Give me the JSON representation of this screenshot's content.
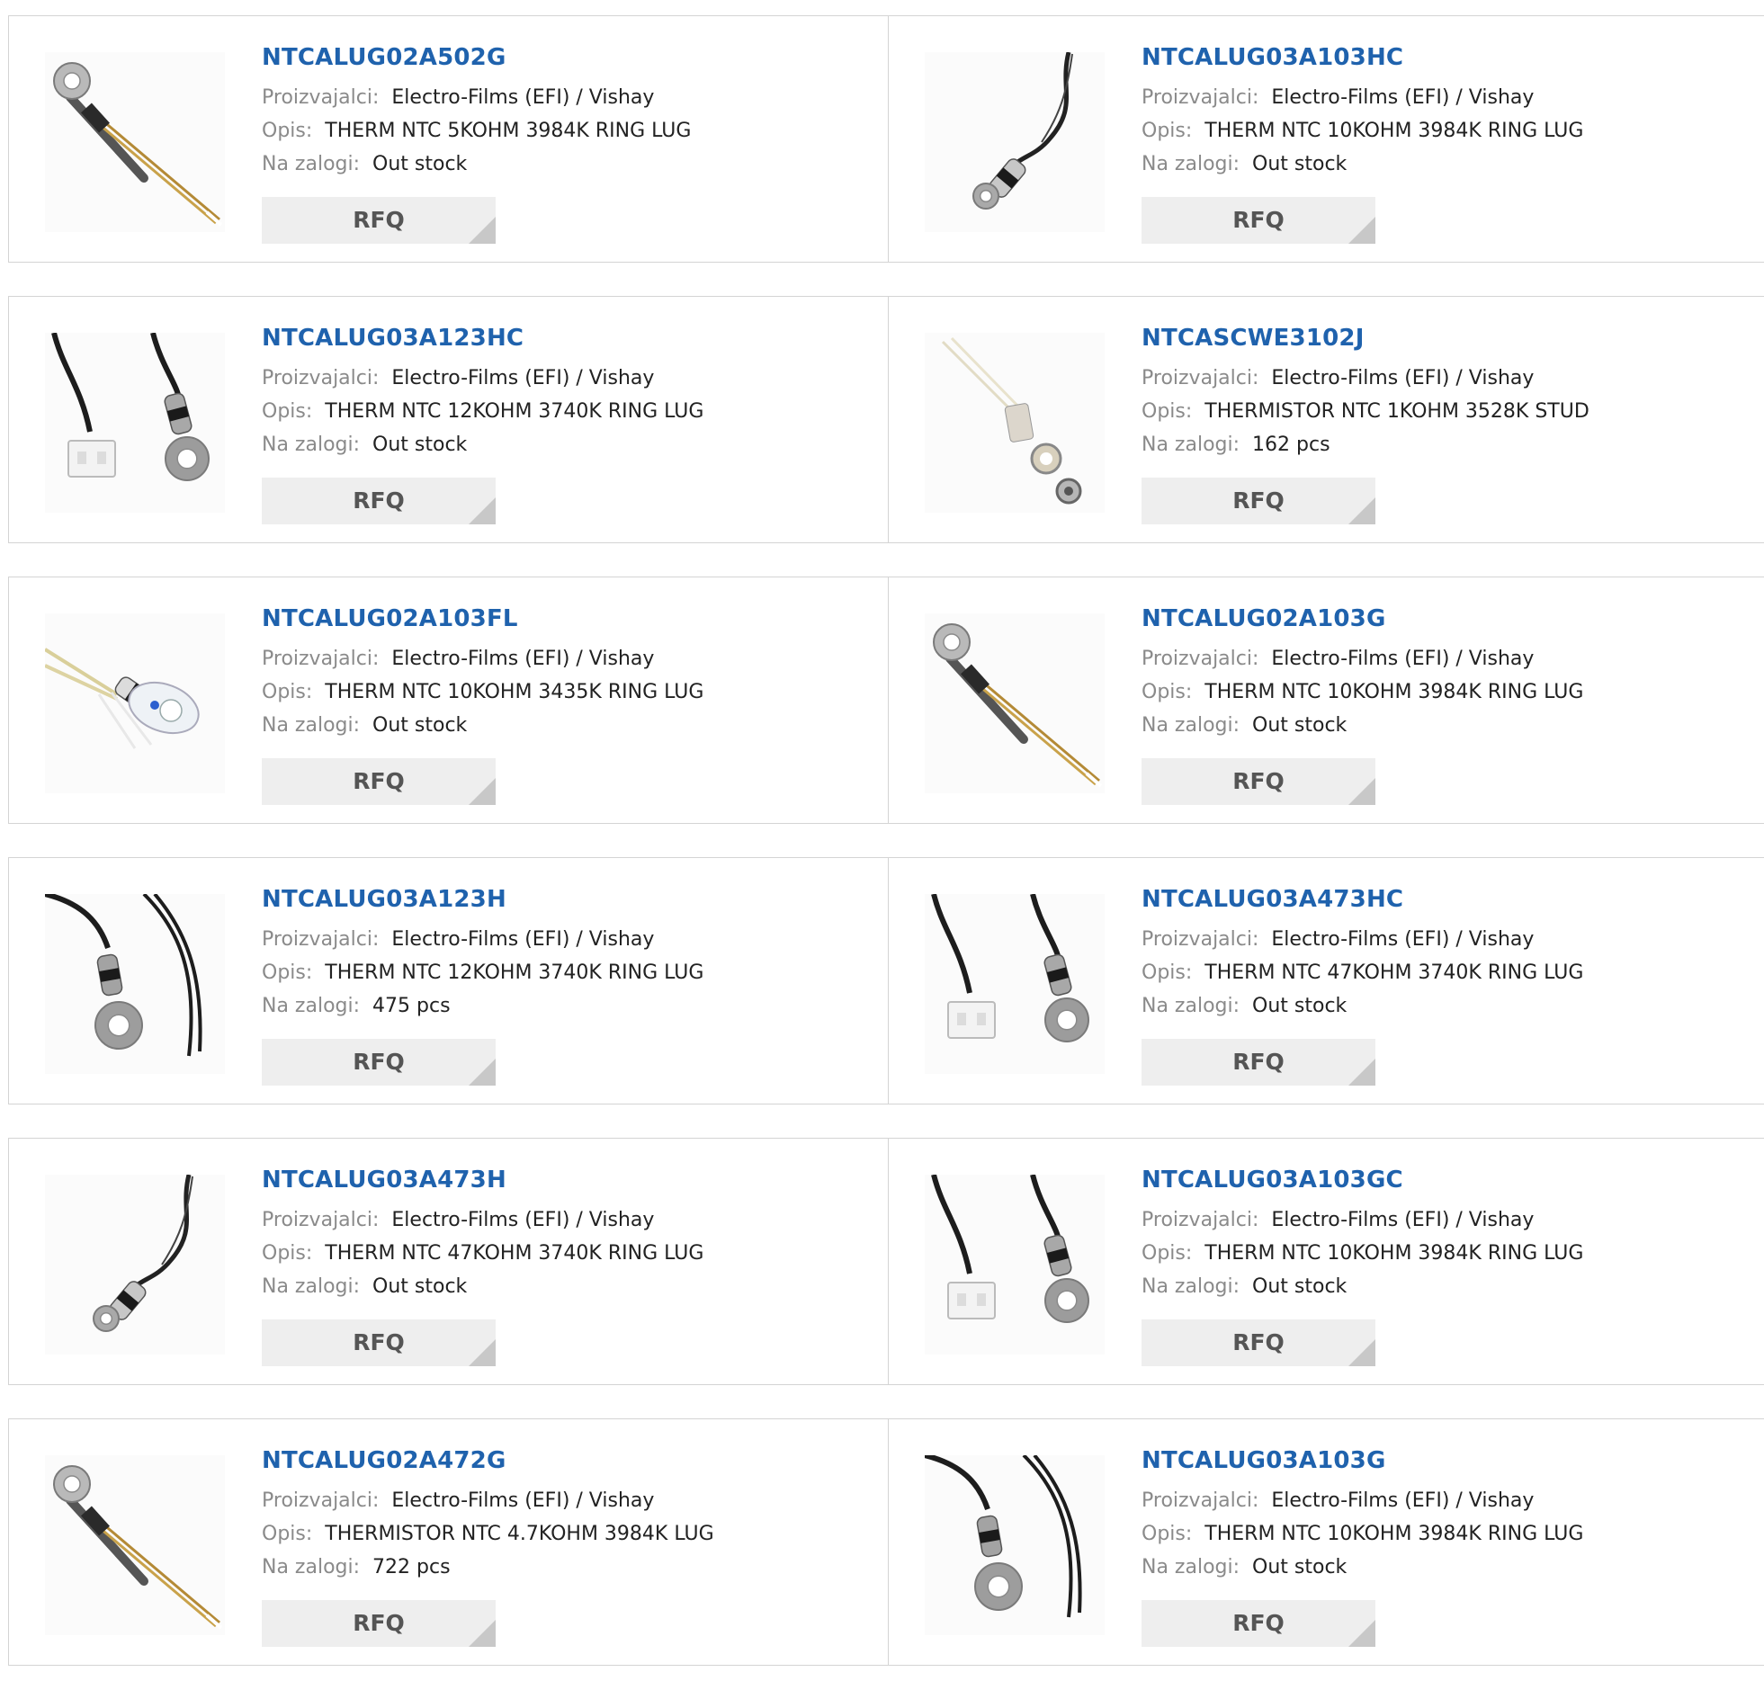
{
  "labels": {
    "manufacturer": "Proizvajalci:",
    "description": "Opis:",
    "stock": "Na zalogi:",
    "rfq": "RFQ"
  },
  "colors": {
    "title": "#1f62ad",
    "label": "#8a8a8a",
    "button_bg": "#eeeeee"
  },
  "products": [
    {
      "part": "NTCALUG02A502G",
      "manufacturer": "Electro-Films (EFI) / Vishay",
      "description": "THERM NTC 5KOHM 3984K RING LUG",
      "stock": "Out stock",
      "image": "ring-lug-gold-leads"
    },
    {
      "part": "NTCALUG03A103HC",
      "manufacturer": "Electro-Films (EFI) / Vishay",
      "description": "THERM NTC 10KOHM 3984K RING LUG",
      "stock": "Out stock",
      "image": "ring-lug-twisted-wire"
    },
    {
      "part": "NTCALUG03A123HC",
      "manufacturer": "Electro-Films (EFI) / Vishay",
      "description": "THERM NTC 12KOHM 3740K RING LUG",
      "stock": "Out stock",
      "image": "ring-lug-connector"
    },
    {
      "part": "NTCASCWE3102J",
      "manufacturer": "Electro-Films (EFI) / Vishay",
      "description": "THERMISTOR NTC 1KOHM 3528K STUD",
      "stock": "162 pcs",
      "image": "stud-washer-nut"
    },
    {
      "part": "NTCALUG02A103FL",
      "manufacturer": "Electro-Films (EFI) / Vishay",
      "description": "THERM NTC 10KOHM 3435K RING LUG",
      "stock": "Out stock",
      "image": "ring-lug-white"
    },
    {
      "part": "NTCALUG02A103G",
      "manufacturer": "Electro-Films (EFI) / Vishay",
      "description": "THERM NTC 10KOHM 3984K RING LUG",
      "stock": "Out stock",
      "image": "ring-lug-gold-leads"
    },
    {
      "part": "NTCALUG03A123H",
      "manufacturer": "Electro-Films (EFI) / Vishay",
      "description": "THERM NTC 12KOHM 3740K RING LUG",
      "stock": "475 pcs",
      "image": "ring-lug-black-leads"
    },
    {
      "part": "NTCALUG03A473HC",
      "manufacturer": "Electro-Films (EFI) / Vishay",
      "description": "THERM NTC 47KOHM 3740K RING LUG",
      "stock": "Out stock",
      "image": "ring-lug-connector"
    },
    {
      "part": "NTCALUG03A473H",
      "manufacturer": "Electro-Films (EFI) / Vishay",
      "description": "THERM NTC 47KOHM 3740K RING LUG",
      "stock": "Out stock",
      "image": "ring-lug-twisted-wire"
    },
    {
      "part": "NTCALUG03A103GC",
      "manufacturer": "Electro-Films (EFI) / Vishay",
      "description": "THERM NTC 10KOHM 3984K RING LUG",
      "stock": "Out stock",
      "image": "ring-lug-connector"
    },
    {
      "part": "NTCALUG02A472G",
      "manufacturer": "Electro-Films (EFI) / Vishay",
      "description": "THERMISTOR NTC 4.7KOHM 3984K LUG",
      "stock": "722 pcs",
      "image": "ring-lug-gold-leads"
    },
    {
      "part": "NTCALUG03A103G",
      "manufacturer": "Electro-Films (EFI) / Vishay",
      "description": "THERM NTC 10KOHM 3984K RING LUG",
      "stock": "Out stock",
      "image": "ring-lug-black-leads"
    }
  ]
}
